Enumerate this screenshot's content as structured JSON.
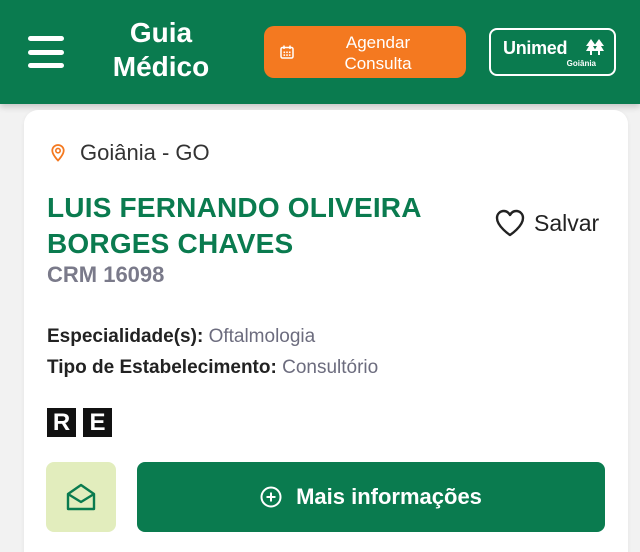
{
  "header": {
    "title_line1": "Guia",
    "title_line2": "Médico",
    "cta_line1": "Agendar",
    "cta_line2": "Consulta",
    "logo_brand": "Unimed",
    "logo_city": "Goiânia",
    "icons": [
      "menu-icon",
      "calendar-icon",
      "unimed-tree-icon"
    ]
  },
  "colors": {
    "primary_green": "#0a7b4f",
    "cta_orange": "#f47920",
    "mail_button_bg": "#e2edbd"
  },
  "result": {
    "location": "Goiânia - GO",
    "name": "LUIS FERNANDO OLIVEIRA BORGES CHAVES",
    "crm": "CRM 16098",
    "save_label": "Salvar",
    "specialty_label": "Especialidade(s):",
    "specialty_value": "Oftalmologia",
    "establishment_label": "Tipo de Estabelecimento:",
    "establishment_value": "Consultório",
    "badges": [
      "R",
      "E"
    ],
    "more_info_label": "Mais informações",
    "icons": [
      "location-pin-icon",
      "heart-icon",
      "mail-icon",
      "plus-circle-icon"
    ]
  }
}
